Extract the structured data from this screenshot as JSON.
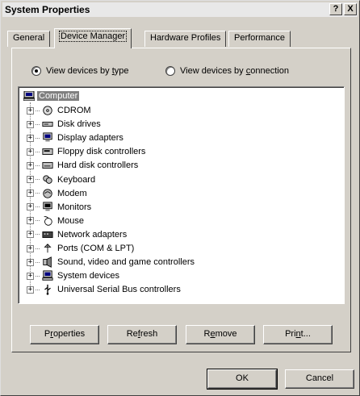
{
  "window": {
    "title": "System Properties",
    "help_label": "?",
    "close_label": "X"
  },
  "tabs": [
    "General",
    "Device Manager",
    "Hardware Profiles",
    "Performance"
  ],
  "view": {
    "by_type": {
      "pre": "View devices by ",
      "key": "t",
      "post": "ype",
      "checked": true
    },
    "by_connection": {
      "pre": "View devices by ",
      "key": "c",
      "post": "onnection",
      "checked": false
    }
  },
  "tree": {
    "root": "Computer",
    "items": [
      {
        "label": "CDROM",
        "icon": "cdrom-icon"
      },
      {
        "label": "Disk drives",
        "icon": "disk-drive-icon"
      },
      {
        "label": "Display adapters",
        "icon": "display-adapter-icon"
      },
      {
        "label": "Floppy disk controllers",
        "icon": "floppy-controller-icon"
      },
      {
        "label": "Hard disk controllers",
        "icon": "hard-disk-controller-icon"
      },
      {
        "label": "Keyboard",
        "icon": "keyboard-icon"
      },
      {
        "label": "Modem",
        "icon": "modem-icon"
      },
      {
        "label": "Monitors",
        "icon": "monitor-icon"
      },
      {
        "label": "Mouse",
        "icon": "mouse-icon"
      },
      {
        "label": "Network adapters",
        "icon": "network-adapter-icon"
      },
      {
        "label": "Ports (COM & LPT)",
        "icon": "ports-icon"
      },
      {
        "label": "Sound, video and game controllers",
        "icon": "sound-icon"
      },
      {
        "label": "System devices",
        "icon": "system-devices-icon"
      },
      {
        "label": "Universal Serial Bus controllers",
        "icon": "usb-icon"
      }
    ]
  },
  "buttons": {
    "properties": {
      "pre": "P",
      "key": "r",
      "post": "operties"
    },
    "refresh": {
      "pre": "Re",
      "key": "f",
      "post": "resh"
    },
    "remove": {
      "pre": "R",
      "key": "e",
      "post": "move"
    },
    "print": {
      "pre": "Pri",
      "key": "n",
      "post": "t..."
    },
    "ok": "OK",
    "cancel": "Cancel"
  }
}
